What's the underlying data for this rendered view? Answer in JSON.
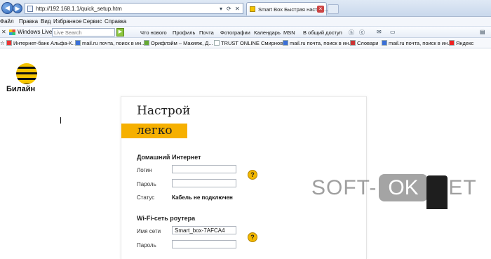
{
  "browser": {
    "url": "http://192.168.1.1/quick_setup.htm",
    "tab_title": "Smart Box Быстрая настро...",
    "tab_close": "×"
  },
  "menu": [
    "Файл",
    "Правка",
    "Вид",
    "Избранное",
    "Сервис",
    "Справка"
  ],
  "live_toolbar": {
    "close": "✕",
    "label": "Windows Live",
    "search_placeholder": "Live Search",
    "links": [
      "Что нового",
      "Профиль",
      "Почта",
      "Фотографии",
      "Календарь",
      "MSN",
      "В общий доступ"
    ]
  },
  "favorites": [
    "Интернет-банк Альфа-К...",
    "mail.ru почта, поиск в ин...",
    "Орифлэйм – Макияж, Д...",
    "TRUST ONLINE Смирнов...",
    "mail.ru почта, поиск в ин...",
    "Словари",
    "mail.ru почта, поиск в ин...",
    "Яндекс"
  ],
  "brand": {
    "name": "Билайн"
  },
  "hero": {
    "line1": "Настрой",
    "line2": "легко"
  },
  "home_internet": {
    "title": "Домашний Интернет",
    "login_label": "Логин",
    "login_value": "",
    "password_label": "Пароль",
    "password_value": "",
    "status_label": "Статус",
    "status_value": "Кабель не подключен"
  },
  "wifi": {
    "title": "Wi-Fi-сеть роутера",
    "ssid_label": "Имя сети",
    "ssid_value": "Smart_box-7AFCA4",
    "password_label": "Пароль",
    "password_value": ""
  },
  "help_symbol": "?",
  "watermark": {
    "prefix": "SOFT-",
    "ok": "OK",
    "suffix": ".NET"
  },
  "colors": {
    "accent": "#f6b000",
    "help": "#f3b800"
  }
}
